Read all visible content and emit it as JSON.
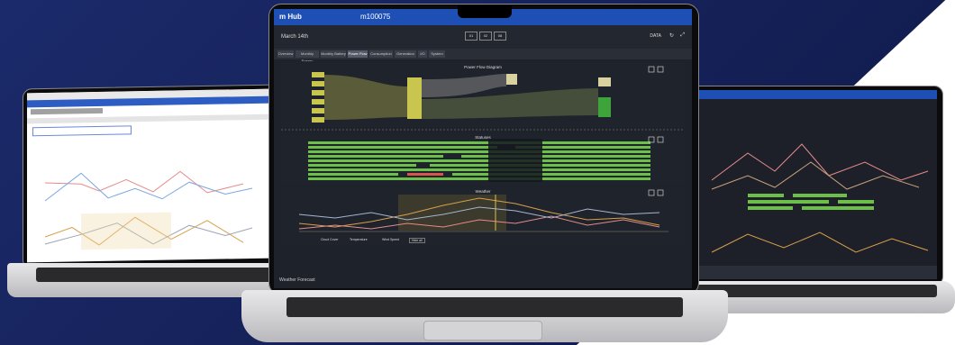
{
  "colors": {
    "accent": "#1e4fb5",
    "bar_green": "#6cc04a",
    "flow_yellow": "#c9c650",
    "battery_green": "#3ea33a",
    "alert_red": "#d9534f"
  },
  "app": {
    "title": "m Hub",
    "device_id": "m100075"
  },
  "subbar": {
    "date": "March 14th",
    "period_buttons": [
      "01",
      "02",
      "08"
    ],
    "data_label": "DATA"
  },
  "tabs": [
    {
      "label": "Overview"
    },
    {
      "label": "Monthly Energy"
    },
    {
      "label": "Monthly Battery"
    },
    {
      "label": "Power Flow"
    },
    {
      "label": "Consumption"
    },
    {
      "label": "Generation"
    },
    {
      "label": "I/O"
    },
    {
      "label": "System"
    }
  ],
  "active_tab": "Power Flow",
  "panels": {
    "power_flow": {
      "title": "Power Flow Diagram"
    },
    "statuses": {
      "title": "Statuses"
    },
    "weather": {
      "title": "Weather",
      "legend": [
        "Cloud Cover",
        "Temperature",
        "Wind Speed",
        "Hide all"
      ]
    }
  },
  "footer": {
    "weather_forecast": "Weather Forecast"
  }
}
